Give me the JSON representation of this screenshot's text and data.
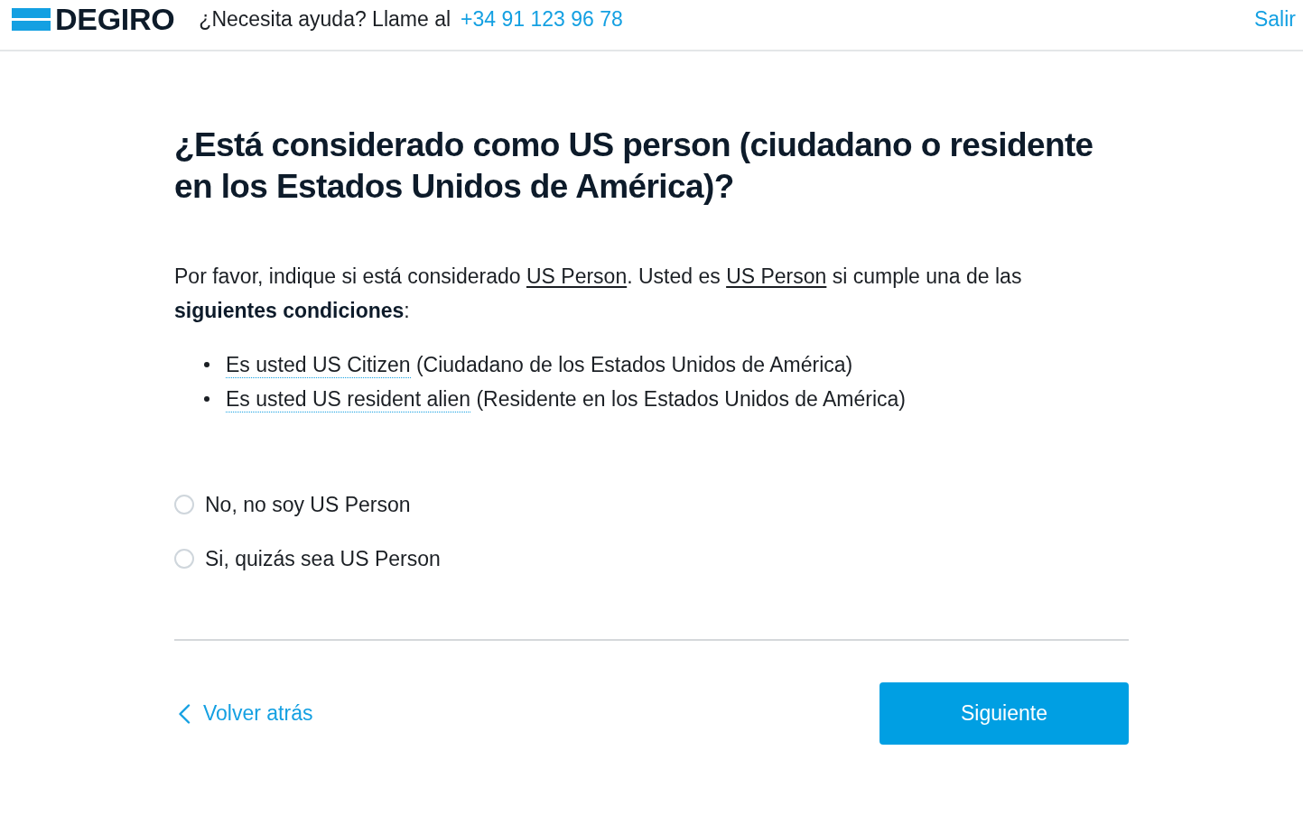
{
  "header": {
    "logo": "DEGIRO",
    "help_text": "¿Necesita ayuda? Llame al",
    "phone": "+34 91 123 96 78",
    "exit_link": "Salir"
  },
  "question": {
    "title": "¿Está considerado como US person (ciudadano o residente en los Estados Unidos de América)?",
    "intro": [
      {
        "kind": "text",
        "text": "Por favor, indique si está considerado "
      },
      {
        "kind": "link",
        "text": "US Person"
      },
      {
        "kind": "text",
        "text": ". Usted es "
      },
      {
        "kind": "link",
        "text": "US Person"
      },
      {
        "kind": "text",
        "text": " si cumple una de las **siguientes condiciones**:"
      }
    ],
    "conditions": [
      {
        "term": "Es usted US Citizen",
        "description": " (Ciudadano de los Estados Unidos de América)"
      },
      {
        "term": "Es usted US resident alien",
        "description": " (Residente en los Estados Unidos de América)"
      }
    ],
    "options": [
      {
        "label": "No, no soy US Person",
        "selected": false
      },
      {
        "label": "Si, quizás sea US Person",
        "selected": false
      }
    ]
  },
  "footer": {
    "back_link": "Volver atrás",
    "next_button": "Siguiente"
  }
}
